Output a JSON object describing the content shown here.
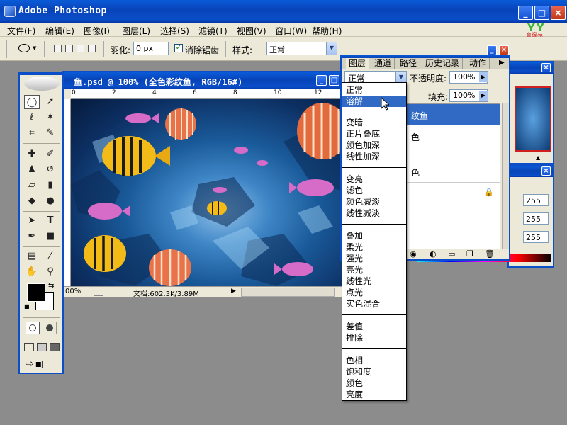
{
  "app": {
    "title": "Adobe Photoshop"
  },
  "menubar": {
    "items": [
      "文件(F)",
      "编辑(E)",
      "图像(I)",
      "图层(L)",
      "选择(S)",
      "滤镜(T)",
      "视图(V)",
      "窗口(W)",
      "帮助(H)"
    ]
  },
  "optionsbar": {
    "feather_label": "羽化:",
    "feather_value": "0 px",
    "antialias_label": "消除锯齿",
    "style_label": "样式:",
    "style_value": "正常"
  },
  "document": {
    "title": "鱼.psd @ 100% (全色彩纹鱼, RGB/16#)",
    "ruler_labels": [
      "0",
      "2",
      "4",
      "6",
      "8",
      "10",
      "12"
    ],
    "zoom": "00%",
    "doc_info": "文档:602.3K/3.89M"
  },
  "layers_panel": {
    "tabs": [
      "图层",
      "通道",
      "路径",
      "历史记录",
      "动作"
    ],
    "blend_mode": "正常",
    "opacity_label": "不透明度:",
    "opacity_value": "100%",
    "fill_label": "填充:",
    "fill_value": "100%",
    "layer_names": [
      "纹鱼",
      "色",
      "色"
    ]
  },
  "color_panel": {
    "values": [
      "255",
      "255",
      "255"
    ]
  },
  "blend_menu": {
    "groups": [
      [
        "正常",
        "溶解"
      ],
      [
        "变暗",
        "正片叠底",
        "颜色加深",
        "线性加深"
      ],
      [
        "变亮",
        "滤色",
        "颜色减淡",
        "线性减淡"
      ],
      [
        "叠加",
        "柔光",
        "强光",
        "亮光",
        "线性光",
        "点光",
        "实色混合"
      ],
      [
        "差值",
        "排除"
      ],
      [
        "色相",
        "饱和度",
        "颜色",
        "亮度"
      ]
    ],
    "highlighted": "溶解"
  },
  "logo": {
    "mark": "YY",
    "sub": "育缘苑"
  },
  "colors": {
    "title_blue": "#0a4ec8",
    "menu_bg": "#ece9d8",
    "highlight": "#316ac5",
    "workspace": "#8c8c8c"
  }
}
